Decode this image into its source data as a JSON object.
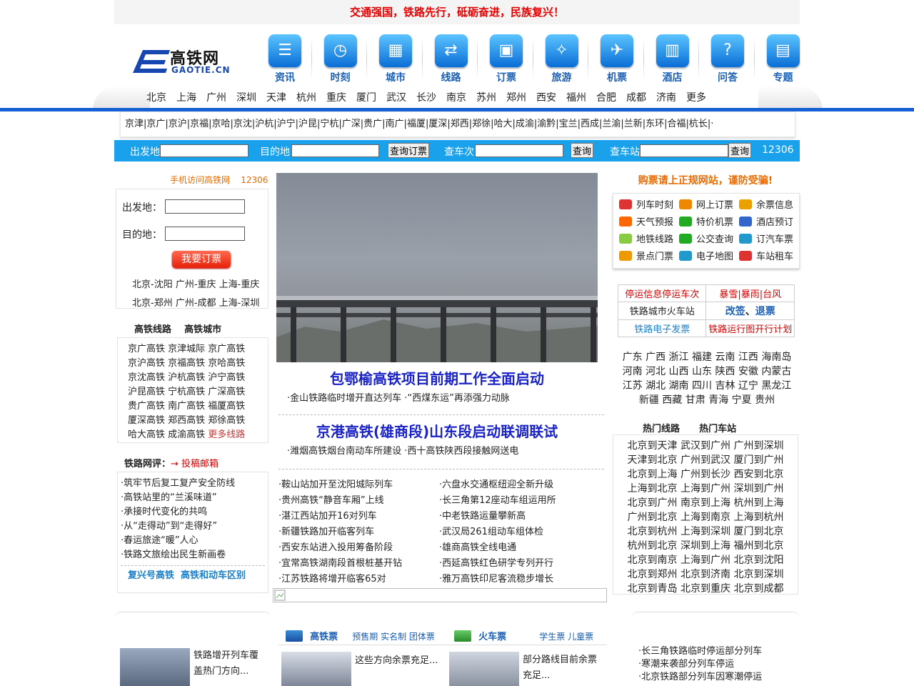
{
  "slogan": "交通强国，铁路先行，砥砺奋进，民族复兴！",
  "logo": {
    "cn": "高铁网",
    "en": "GAOTIE.CN"
  },
  "nav": [
    {
      "label": "资讯",
      "icon": "list-icon",
      "glyph": "☰"
    },
    {
      "label": "时刻",
      "icon": "clock-icon",
      "glyph": "◷"
    },
    {
      "label": "城市",
      "icon": "city-icon",
      "glyph": "▦"
    },
    {
      "label": "线路",
      "icon": "route-icon",
      "glyph": "⇄"
    },
    {
      "label": "订票",
      "icon": "ticket-icon",
      "glyph": "▣"
    },
    {
      "label": "旅游",
      "icon": "compass-icon",
      "glyph": "✧"
    },
    {
      "label": "机票",
      "icon": "plane-icon",
      "glyph": "✈"
    },
    {
      "label": "酒店",
      "icon": "hotel-icon",
      "glyph": "▥"
    },
    {
      "label": "问答",
      "icon": "question-icon",
      "glyph": "?"
    },
    {
      "label": "专题",
      "icon": "book-icon",
      "glyph": "▤"
    }
  ],
  "cities": [
    "北京",
    "上海",
    "广州",
    "深圳",
    "天津",
    "杭州",
    "重庆",
    "厦门",
    "武汉",
    "长沙",
    "南京",
    "苏州",
    "郑州",
    "西安",
    "福州",
    "合肥",
    "成都",
    "济南",
    "更多"
  ],
  "routes_line": "京津|京广|京沪|京福|京哈|京沈|沪杭|沪宁|沪昆|宁杭|广深|贵广|南广|福厦|厦深|郑西|郑徐|哈大|成渝|渝黔|宝兰|西成|兰渝|兰新|东环|合福|杭长|·",
  "search": {
    "from_label": "出发地",
    "to_label": "目的地",
    "order_btn": "查询订票",
    "train_label": "查车次",
    "train_btn": "查询",
    "station_label": "查车站",
    "station_btn": "查询",
    "tel": "12306"
  },
  "left": {
    "mobile": "手机访问高铁网",
    "tel": "12306",
    "from_label": "出发地：",
    "to_label": "目的地：",
    "book_btn": "我要订票",
    "quick_routes_1": "北京-沈阳 广州-重庆 上海-重庆",
    "quick_routes_2": "北京-郑州 广州-成都 上海-深圳",
    "tab_lines": "高铁线路",
    "tab_cities": "高铁城市",
    "lines": [
      "京广高铁 京津城际 京广高铁",
      "京沪高铁 京福高铁 京哈高铁",
      "京沈高铁 沪杭高铁 沪宁高铁",
      "沪昆高铁 宁杭高铁 广深高铁",
      "贵广高铁 南广高铁 福厦高铁",
      "厦深高铁 郑西高铁 郑徐高铁"
    ],
    "lines_last": "哈大高铁 成渝高铁 ",
    "more_lines": "更多线路",
    "review_title": "铁路网评",
    "review_colon": "：",
    "submit": "→ 投稿邮箱",
    "reviews": [
      "·筑牢节后复工复产安全防线",
      "·高铁站里的“兰溪味道”",
      "·承接时代变化的共鸣",
      "·从“走得动”到“走得好”",
      "·春运旅途“暖”人心",
      "·铁路文旅绘出民生新画卷"
    ],
    "bottom_links": "复兴号高铁  高铁和动车区别"
  },
  "center": {
    "headline1": "包鄂榆高铁项目前期工作全面启动",
    "sub1": "·金山铁路临时增开直达列车 ·“西煤东运”再添强力动脉",
    "headline2": "京港高铁(雄商段)山东段启动联调联试",
    "sub2": "·潍烟高铁烟台南动车所建设 ·西十高铁陕西段接触网送电",
    "news_left": [
      "·鞍山站加开至沈阳城际列车",
      "·贵州高铁“静音车厢”上线",
      "·湛江西站加开16对列车",
      "·新疆铁路加开临客列车",
      "·西安东站进入投用筹备阶段",
      "·宜常高铁湖南段首根桩基开钻",
      "·江苏铁路将增开临客65对"
    ],
    "news_right": [
      "·六盘水交通枢纽迎全新升级",
      "·长三角第12座动车组运用所",
      "·中老铁路运量攀新高",
      "·武汉局261组动车组体检",
      "·雄商高铁全线电通",
      "·西延高铁红色研学专列开行",
      "·雅万高铁印尼客流稳步增长"
    ]
  },
  "right": {
    "warn": "购票请上正规网站，谨防受骗!",
    "services": [
      {
        "label": "列车时刻",
        "icon": "train-icon",
        "color": "#d33"
      },
      {
        "label": "网上订票",
        "icon": "ticket-icon",
        "color": "#e80"
      },
      {
        "label": "余票信息",
        "icon": "question-icon",
        "color": "#e9a000"
      },
      {
        "label": "天气预报",
        "icon": "weather-icon",
        "color": "#f60"
      },
      {
        "label": "特价机票",
        "icon": "plane-icon",
        "color": "#2a2"
      },
      {
        "label": "酒店预订",
        "icon": "chart-icon",
        "color": "#36c"
      },
      {
        "label": "地铁线路",
        "icon": "subway-icon",
        "color": "#8c4"
      },
      {
        "label": "公交查询",
        "icon": "bus-icon",
        "color": "#2a2"
      },
      {
        "label": "订汽车票",
        "icon": "coach-icon",
        "color": "#29c"
      },
      {
        "label": "景点门票",
        "icon": "palm-icon",
        "color": "#e90"
      },
      {
        "label": "电子地图",
        "icon": "globe-icon",
        "color": "#29c"
      },
      {
        "label": "车站租车",
        "icon": "car-icon",
        "color": "#d33"
      }
    ],
    "box": {
      "stop": "停运信息停运车次",
      "storm": "暴雪|暴雨|台风",
      "stations": "铁路城市火车站",
      "change": "改签",
      "dot": "、",
      "refund": "退票",
      "invoice": "铁路电子发票",
      "plan": "铁路运行图开行计划"
    },
    "provinces": [
      "广东 广西 浙江 福建 云南 江西 海南岛",
      "河南 河北 山西 山东 陕西 安徽 内蒙古",
      "江苏 湖北 湖南 四川 吉林 辽宁 黑龙江",
      "新疆 西藏 甘肃 青海 宁夏 贵州"
    ],
    "tab_routes": "热门线路",
    "tab_stations": "热门车站",
    "hot": [
      "北京到天津 武汉到广州 广州到深圳",
      "天津到北京 广州到武汉 厦门到广州",
      "北京到上海 广州到长沙 西安到北京",
      "上海到北京 上海到广州 深圳到广州",
      "北京到广州 南京到上海 杭州到上海",
      "广州到北京 上海到南京 上海到杭州",
      "北京到杭州 上海到深圳 厦门到北京",
      "杭州到北京 深圳到上海 福州到北京",
      "北京到南京 上海到广州 北京到沈阳",
      "北京到郑州 北京到济南 北京到深圳",
      "北京到青岛 北京到重庆 北京到成都"
    ]
  },
  "bottom": {
    "gaotie_title": "高铁票",
    "gaotie_links": "预售期 实名制 团体票",
    "huoche_title": "火车票",
    "huoche_links": "学生票 儿童票",
    "left_caption": "铁路增开列车覆盖热门方向...",
    "mid1_caption": "这些方向余票充足...",
    "mid2_caption": "部分路线目前余票充足...",
    "right_news": [
      "·长三角铁路临时停运部分列车",
      "·寒潮来袭部分列车停运",
      "·北京铁路部分列车因寒潮停运"
    ]
  }
}
